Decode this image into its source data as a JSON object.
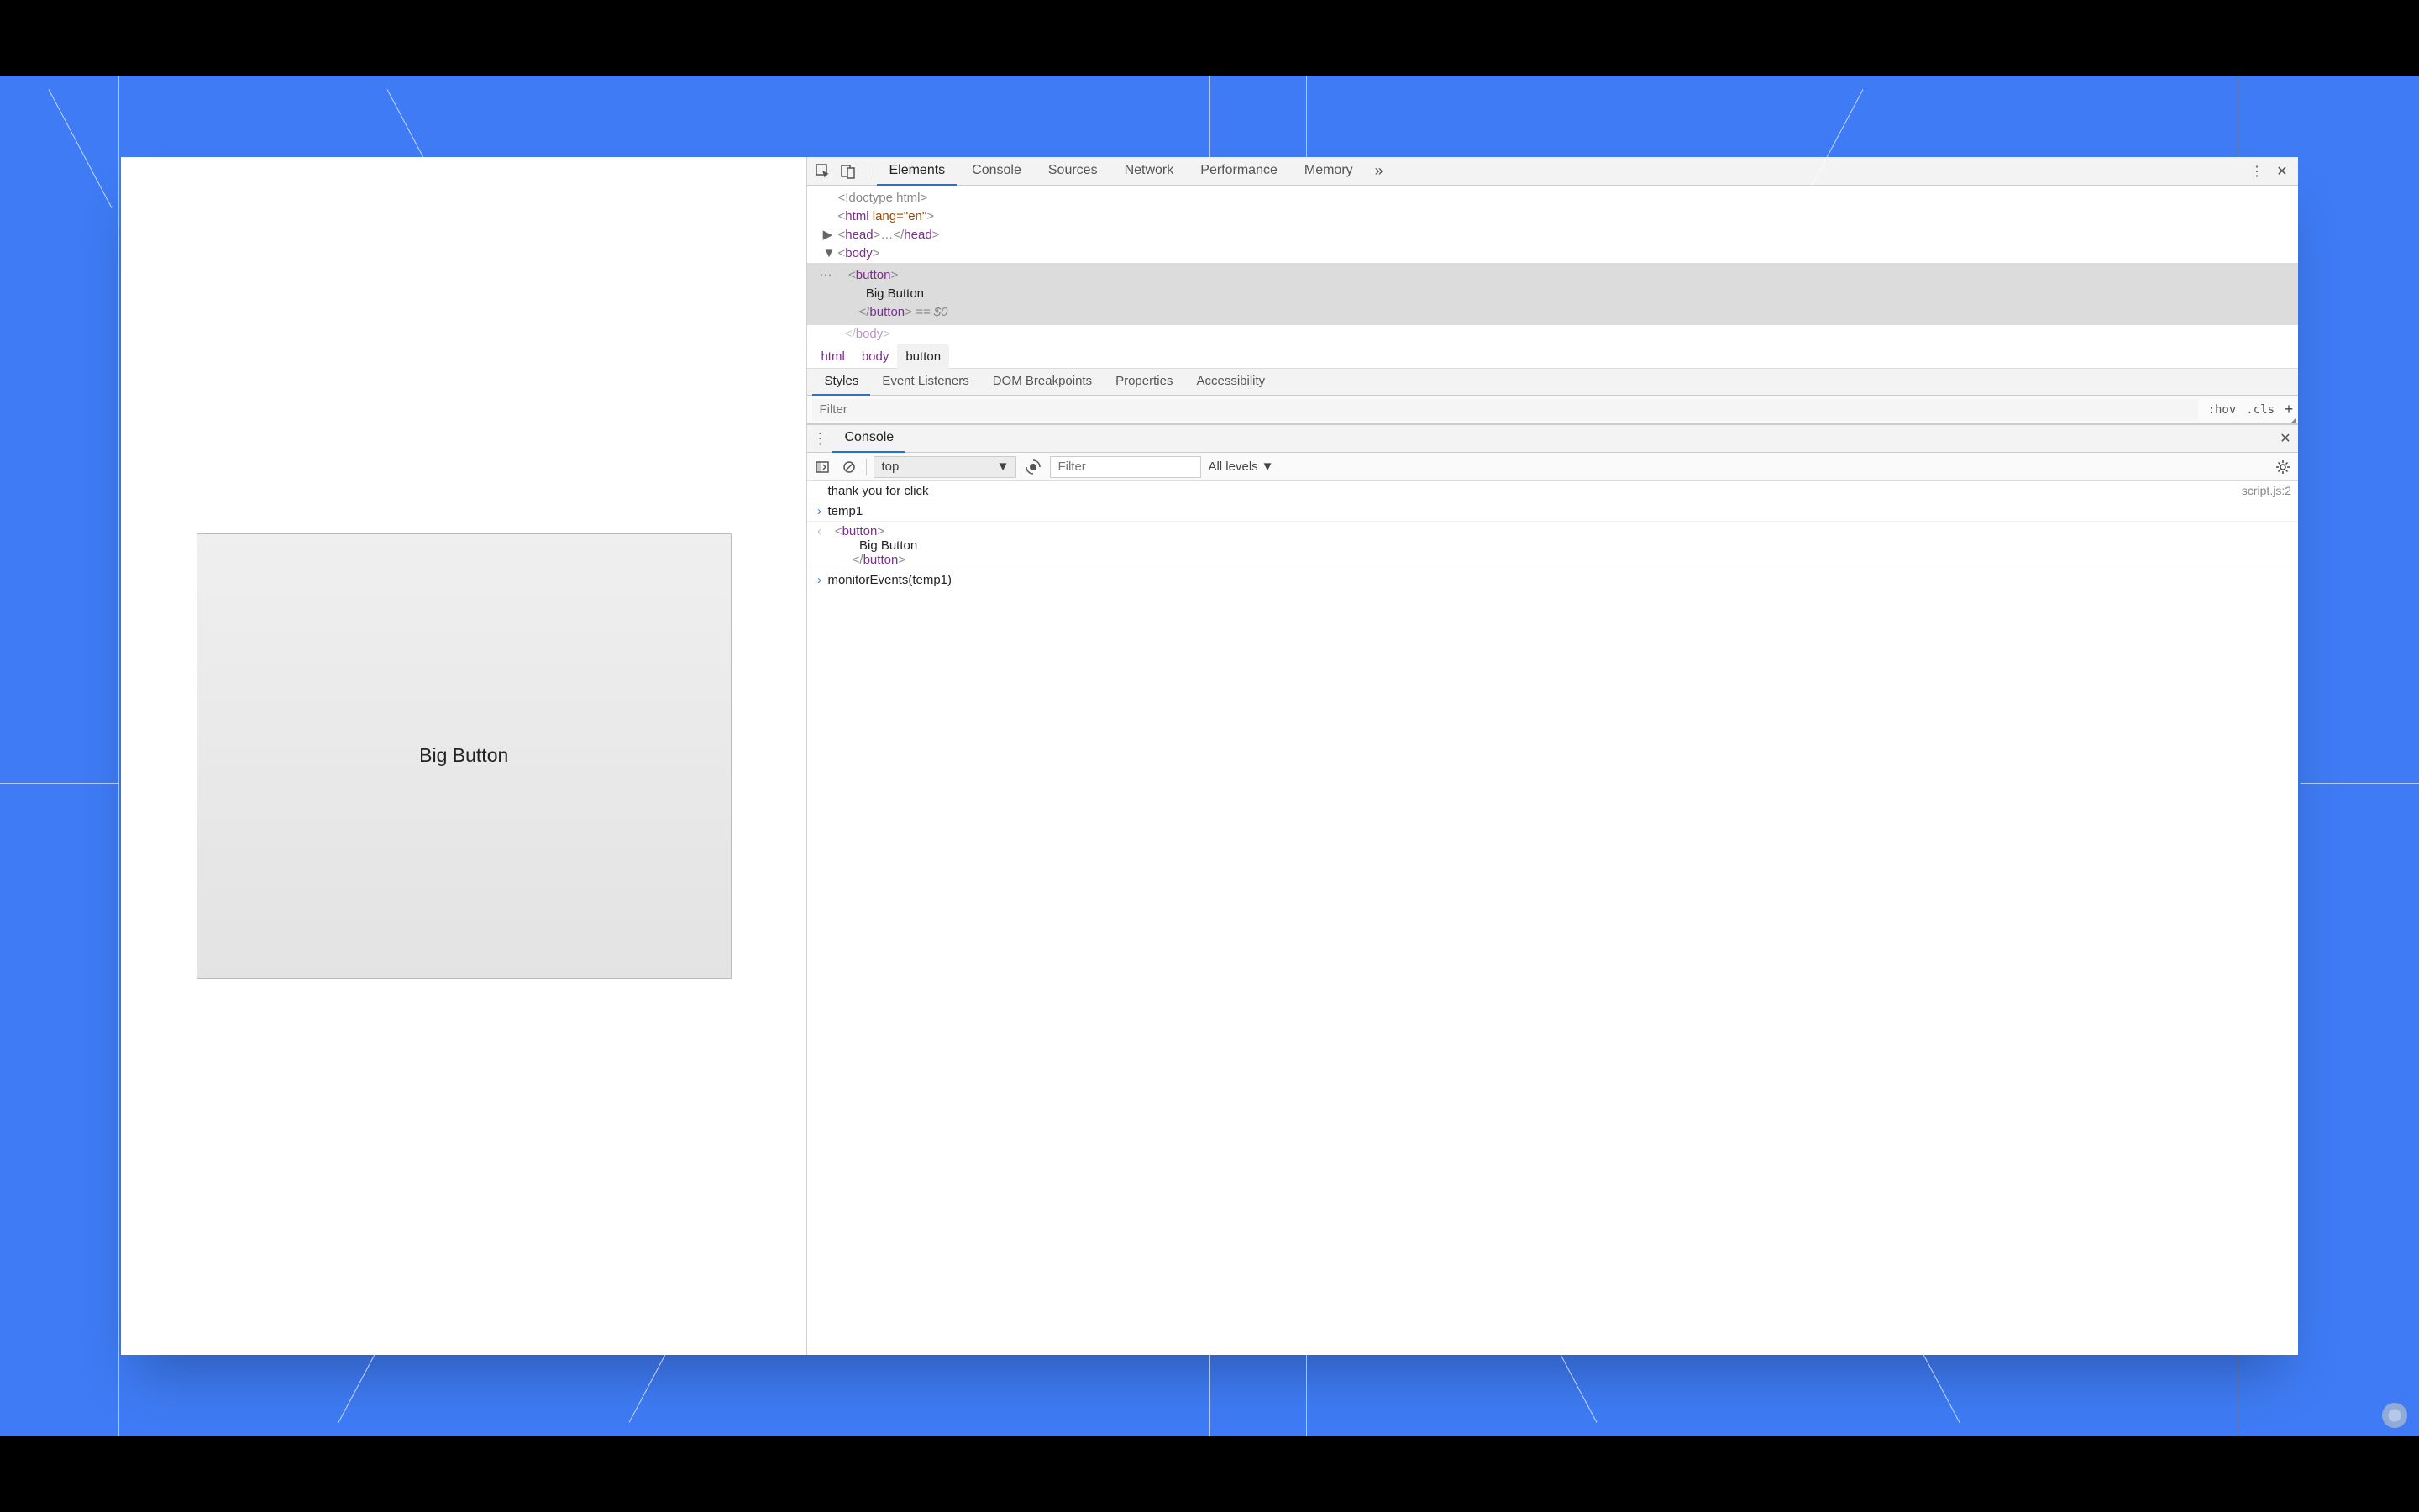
{
  "page": {
    "big_button_label": "Big Button"
  },
  "devtools": {
    "tabs": [
      "Elements",
      "Console",
      "Sources",
      "Network",
      "Performance",
      "Memory"
    ],
    "active_tab": "Elements",
    "dom": {
      "l1": "<!doctype html>",
      "l2_open": "<",
      "l2_tag": "html",
      "l2_attr": " lang=\"en\"",
      "l2_close": ">",
      "l3_open": "<",
      "l3_tag": "head",
      "l3_mid": ">…</",
      "l3_tag2": "head",
      "l3_close": ">",
      "l4_open": "<",
      "l4_tag": "body",
      "l4_close": ">",
      "sel_open": "<",
      "sel_tag": "button",
      "sel_close": ">",
      "sel_text": "Big Button",
      "sel_end_open": "</",
      "sel_end_tag": "button",
      "sel_end_close": ">",
      "sel_ref": " == $0",
      "l6_open": "</",
      "l6_tag": "body",
      "l6_close": ">"
    },
    "breadcrumbs": [
      "html",
      "body",
      "button"
    ],
    "subtabs": [
      "Styles",
      "Event Listeners",
      "DOM Breakpoints",
      "Properties",
      "Accessibility"
    ],
    "active_subtab": "Styles",
    "filter_placeholder": "Filter",
    "hov": ":hov",
    "cls": ".cls"
  },
  "drawer": {
    "tab": "Console",
    "context": "top",
    "filter_placeholder": "Filter",
    "levels": "All levels",
    "log_msg": "thank you for click",
    "log_src": "script.js:2",
    "input1": "temp1",
    "out_open": "<",
    "out_tag": "button",
    "out_close": ">",
    "out_text": "Big Button",
    "out_end_open": "</",
    "out_end_tag": "button",
    "out_end_close": ">",
    "input2": "monitorEvents(temp1)"
  }
}
